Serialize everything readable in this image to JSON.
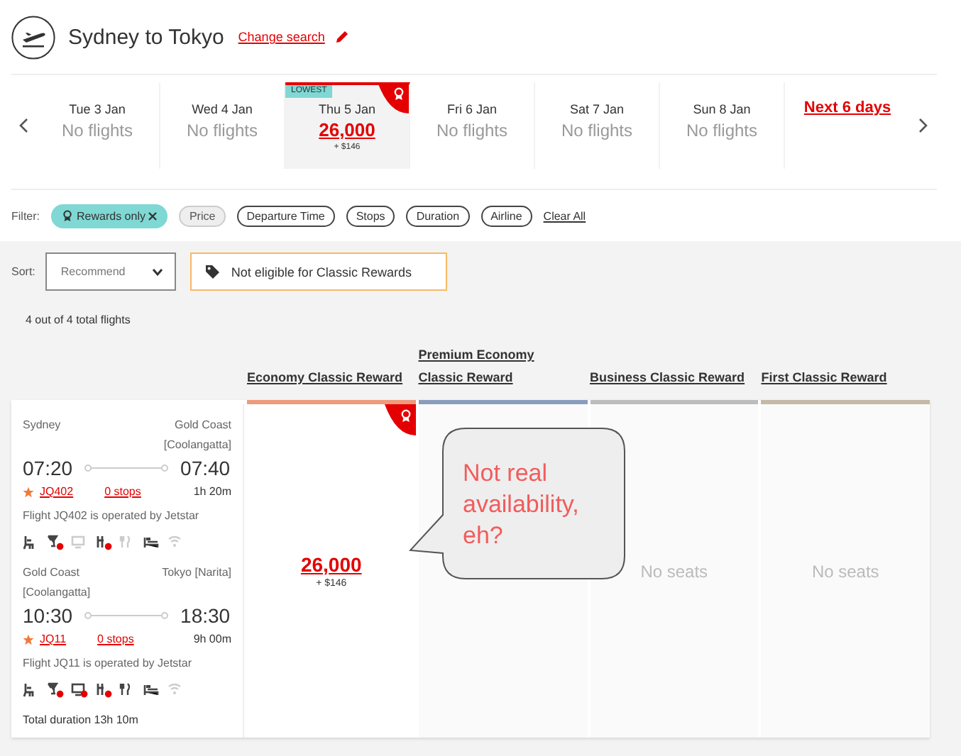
{
  "header": {
    "title": "Sydney to Tokyo",
    "change_link": "Change search"
  },
  "dates": [
    {
      "day": "Tue 3 Jan",
      "status": "No flights",
      "selected": false
    },
    {
      "day": "Wed 4 Jan",
      "status": "No flights",
      "selected": false
    },
    {
      "day": "Thu 5 Jan",
      "points": "26,000",
      "taxes": "+ $146",
      "tag": "LOWEST",
      "reward": true,
      "selected": true
    },
    {
      "day": "Fri 6 Jan",
      "status": "No flights",
      "selected": false
    },
    {
      "day": "Sat 7 Jan",
      "status": "No flights",
      "selected": false
    },
    {
      "day": "Sun 8 Jan",
      "status": "No flights",
      "selected": false
    }
  ],
  "next_link": "Next 6 days",
  "filters": {
    "label": "Filter:",
    "chips": [
      {
        "label": "Rewards only",
        "selected": true,
        "disabled": false
      },
      {
        "label": "Price",
        "selected": false,
        "disabled": true
      },
      {
        "label": "Departure Time",
        "selected": false,
        "disabled": false
      },
      {
        "label": "Stops",
        "selected": false,
        "disabled": false
      },
      {
        "label": "Duration",
        "selected": false,
        "disabled": false
      },
      {
        "label": "Airline",
        "selected": false,
        "disabled": false
      }
    ],
    "clear": "Clear All"
  },
  "sort": {
    "label": "Sort:",
    "value": "Recommend"
  },
  "notice": "Not eligible for Classic Rewards",
  "count": "4 out of 4 total flights",
  "columns": [
    {
      "name": "Economy Classic Reward",
      "color": "#ee9a7c"
    },
    {
      "name": "Premium Economy Classic Reward",
      "color": "#8a9cbd"
    },
    {
      "name": "Business Classic Reward",
      "color": "#bcbcbc"
    },
    {
      "name": "First Classic Reward",
      "color": "#c5b9a6"
    }
  ],
  "flight": {
    "segments": [
      {
        "from": "Sydney",
        "to": "Gold Coast [Coolangatta]",
        "depart": "07:20",
        "arrive": "07:40",
        "number": "JQ402",
        "stops": "0 stops",
        "duration": "1h 20m",
        "operator": "Flight JQ402 is operated by Jetstar",
        "amenities": [
          {
            "kind": "seat",
            "available": true,
            "badge": false
          },
          {
            "kind": "drink",
            "available": true,
            "badge": true
          },
          {
            "kind": "screen",
            "available": false,
            "badge": false
          },
          {
            "kind": "power",
            "available": true,
            "badge": true
          },
          {
            "kind": "meal",
            "available": false,
            "badge": false
          },
          {
            "kind": "bed",
            "available": true,
            "badge": false
          },
          {
            "kind": "wifi",
            "available": false,
            "badge": false
          }
        ]
      },
      {
        "from": "Gold Coast [Coolangatta]",
        "to": "Tokyo [Narita]",
        "depart": "10:30",
        "arrive": "18:30",
        "number": "JQ11",
        "stops": "0 stops",
        "duration": "9h 00m",
        "operator": "Flight JQ11 is operated by Jetstar",
        "amenities": [
          {
            "kind": "seat",
            "available": true,
            "badge": false
          },
          {
            "kind": "drink",
            "available": true,
            "badge": true
          },
          {
            "kind": "screen",
            "available": true,
            "badge": true
          },
          {
            "kind": "power",
            "available": true,
            "badge": true
          },
          {
            "kind": "meal",
            "available": true,
            "badge": false
          },
          {
            "kind": "bed",
            "available": true,
            "badge": false
          },
          {
            "kind": "wifi",
            "available": false,
            "badge": false
          }
        ]
      }
    ],
    "total": "Total duration 13h 10m",
    "fares": [
      {
        "kind": "price",
        "points": "26,000",
        "taxes": "+ $146",
        "reward": true
      },
      {
        "kind": "blank"
      },
      {
        "kind": "none",
        "text": "No seats"
      },
      {
        "kind": "none",
        "text": "No seats"
      }
    ]
  },
  "callout": "Not real availability, eh?"
}
